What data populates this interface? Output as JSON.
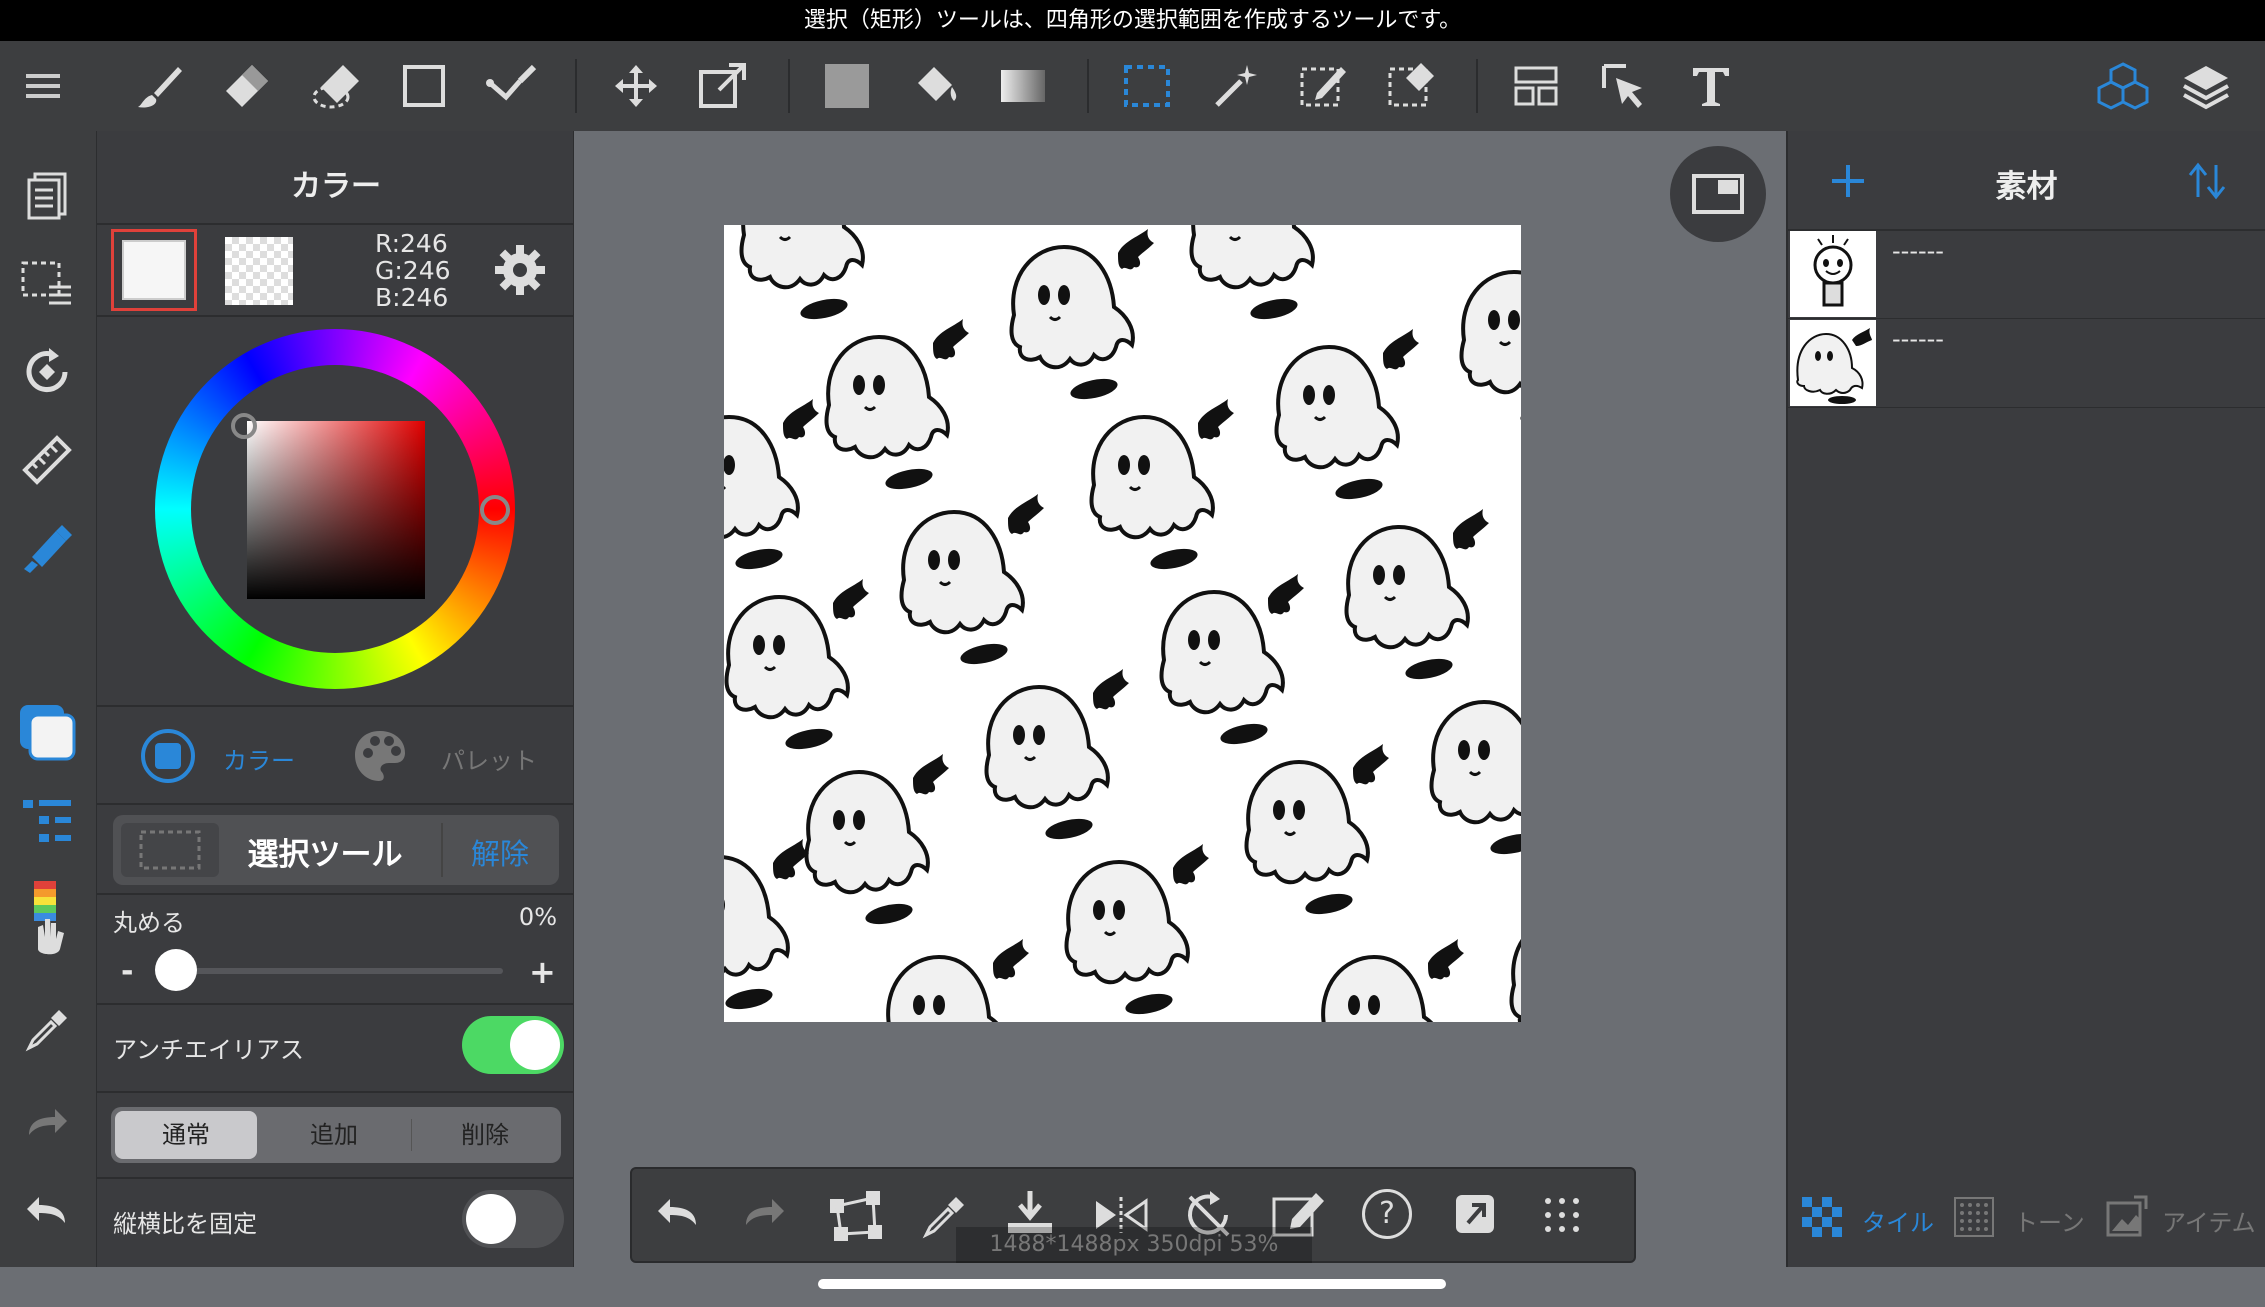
{
  "hint_bar": {
    "text": "選択（矩形）ツールは、四角形の選択範囲を作成するツールです。"
  },
  "toolbar": {
    "icons": [
      "menu-icon",
      "brush-icon",
      "eraser-icon",
      "blur-eraser-icon",
      "rectangle-icon",
      "pen-check-icon",
      "move-icon",
      "transform-icon",
      "fill-color-icon",
      "bucket-icon",
      "gradient-icon",
      "select-rect-icon",
      "magic-wand-icon",
      "select-pen-icon",
      "select-eraser-icon",
      "frame-divide-icon",
      "select-pointer-icon",
      "text-icon",
      "material-icon",
      "layers-icon"
    ]
  },
  "left_rail": {
    "icons": [
      "pages-icon",
      "selection-list-icon",
      "rotate-canvas-icon",
      "ruler-icon",
      "fill-pen-icon",
      "color-swatch-icon",
      "brush-list-icon",
      "hand-rainbow-icon",
      "eyedropper-icon",
      "redo-icon",
      "undo-icon"
    ]
  },
  "color_panel": {
    "title": "カラー",
    "rgb": {
      "r": "R:246",
      "g": "G:246",
      "b": "B:246"
    },
    "tabs": {
      "color": "カラー",
      "palette": "パレット"
    },
    "active_tab_color": "#2a87d8"
  },
  "selection_tool": {
    "title": "選択ツール",
    "release": "解除",
    "round_label": "丸める",
    "round_value": "0%",
    "round_fraction": 0,
    "minus": "-",
    "plus": "+",
    "antialias_label": "アンチエイリアス",
    "antialias_on": true,
    "modes": [
      "通常",
      "追加",
      "削除"
    ],
    "active_mode": "通常",
    "aspect_label": "縦横比を固定",
    "aspect_on": false,
    "toggle_on_color": "#4cd964"
  },
  "canvas": {
    "info": "1488*1488px 350dpi 53%"
  },
  "material_panel": {
    "title": "素材",
    "items": [
      {
        "name": "------"
      },
      {
        "name": "------"
      }
    ],
    "bottom_tabs": {
      "tile": "タイル",
      "tone": "トーン",
      "item": "アイテム"
    },
    "accent": "#2a87d8"
  },
  "bottom_toolbar": {
    "icons": [
      "undo-icon",
      "redo-icon",
      "transform-free-icon",
      "eyedropper-icon",
      "save-icon",
      "flip-icon",
      "rotate-reset-icon",
      "edit-select-icon",
      "help-icon",
      "share-icon",
      "more-icon"
    ],
    "help": "?"
  }
}
